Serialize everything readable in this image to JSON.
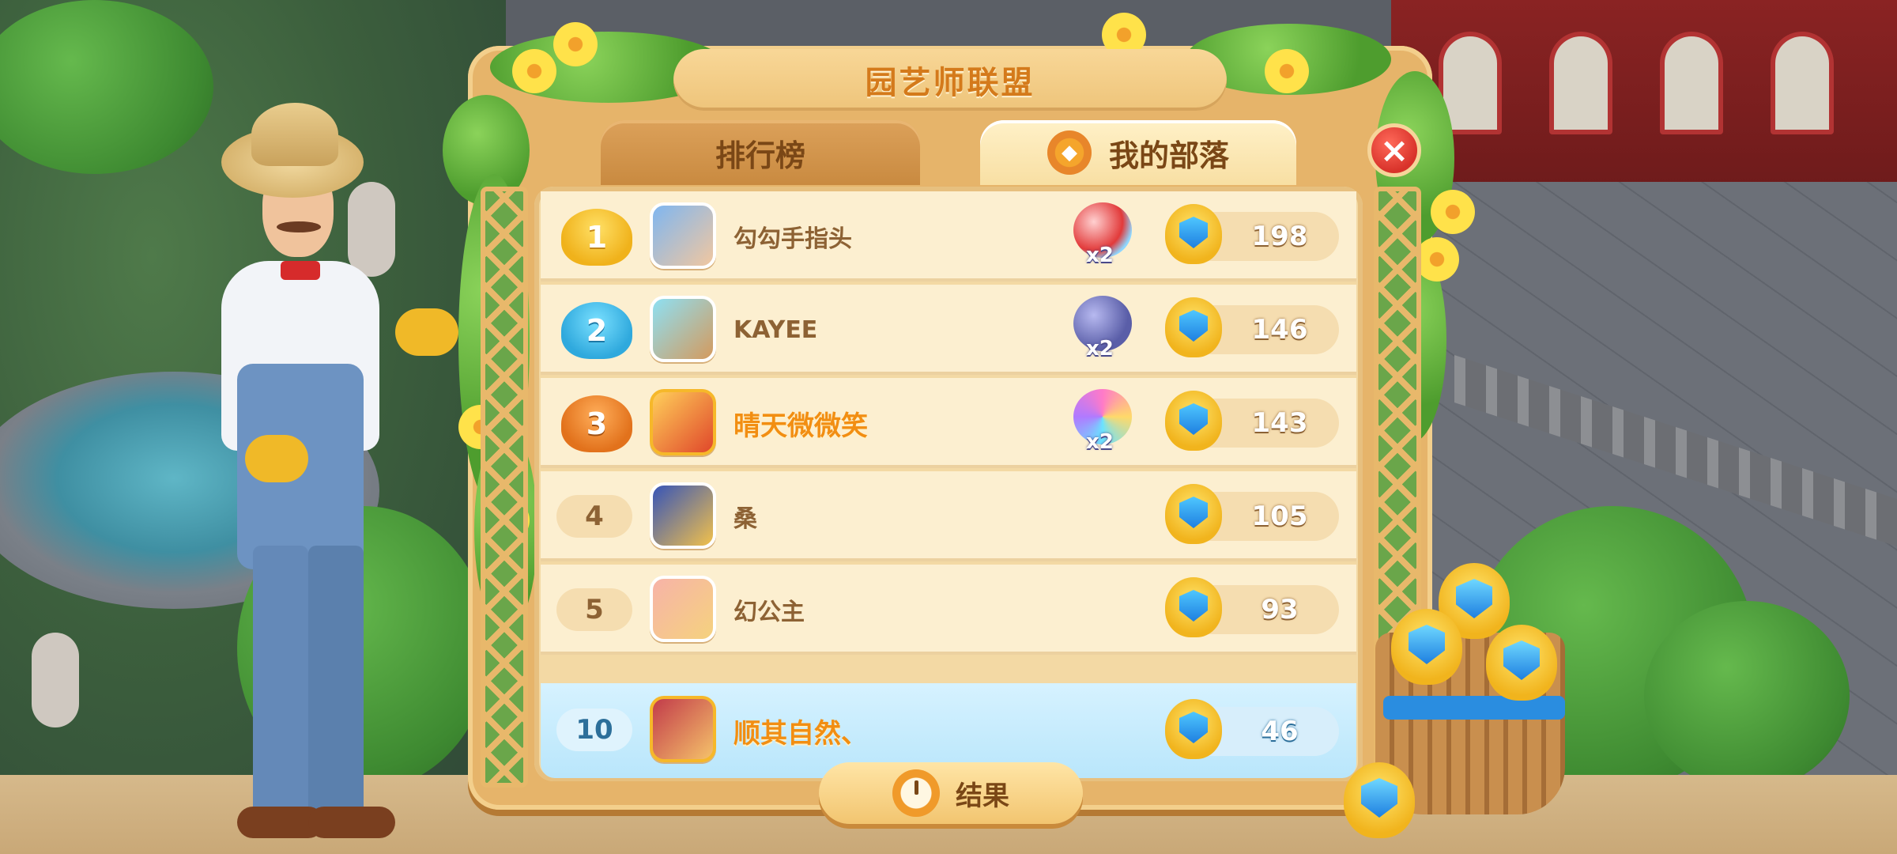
{
  "header": {
    "title": "园艺师联盟"
  },
  "tabs": [
    {
      "label": "排行榜",
      "active": false
    },
    {
      "label": "我的部落",
      "active": true,
      "icon": "tribe-shield-icon"
    }
  ],
  "close_icon": "close-icon",
  "leaderboard": [
    {
      "rank": "1",
      "rank_style": "gold-cup",
      "name": "勾勾手指头",
      "reward": "rocket-booster",
      "reward_mult": "x2",
      "score": "198"
    },
    {
      "rank": "2",
      "rank_style": "blue-cup",
      "name": "KAYEE",
      "reward": "bomb-booster",
      "reward_mult": "x2",
      "score": "146"
    },
    {
      "rank": "3",
      "rank_style": "bronze-cup",
      "name": "晴天微微笑",
      "reward": "rainbow-disc-booster",
      "reward_mult": "x2",
      "score": "143"
    },
    {
      "rank": "4",
      "rank_style": "plain",
      "name": "桑",
      "score": "105"
    },
    {
      "rank": "5",
      "rank_style": "plain",
      "name": "幻公主",
      "score": "93"
    }
  ],
  "my_entry": {
    "rank": "10",
    "name": "顺其自然、",
    "score": "46"
  },
  "footer": {
    "result_label": "结果"
  },
  "colors": {
    "frame": "#e6b46a",
    "title_text": "#d47a1b",
    "highlight_row": "#b9e6fb",
    "close_button": "#d8322a"
  }
}
